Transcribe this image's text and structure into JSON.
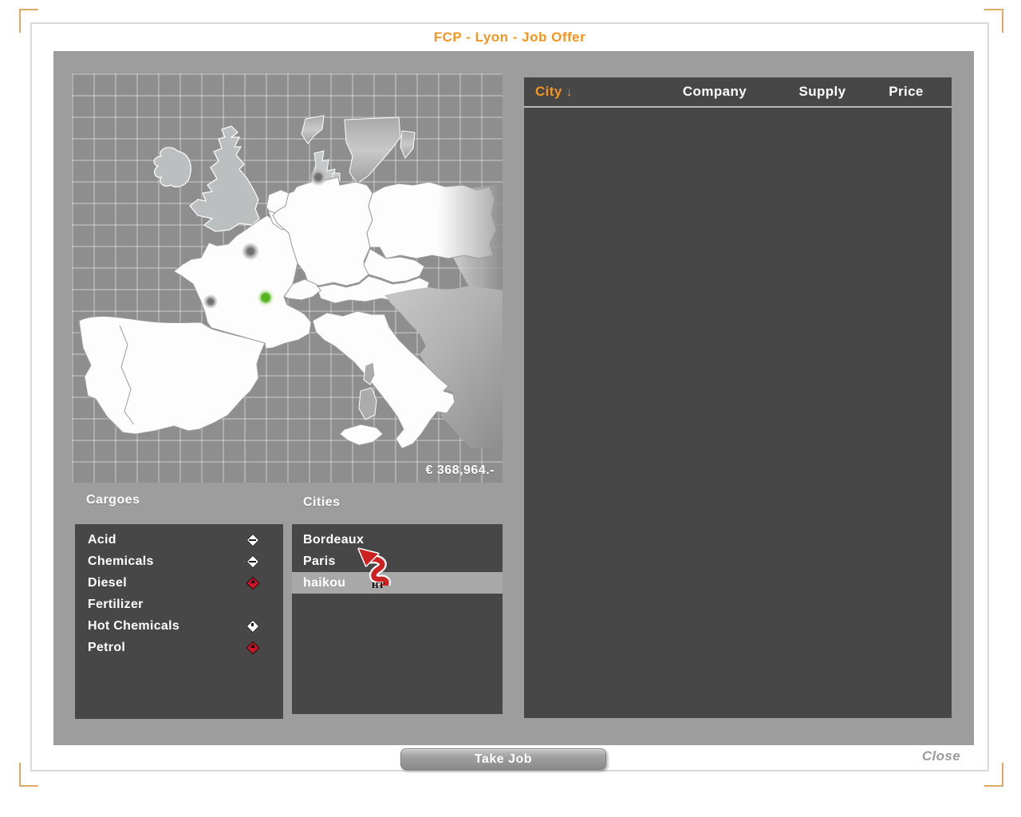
{
  "window": {
    "title": "FCP - Lyon - Job Offer"
  },
  "map": {
    "money_label": "€ 368,964.-",
    "dots": [
      {
        "name": "city-dot-north",
        "type": "gray"
      },
      {
        "name": "city-dot-paris",
        "type": "gray"
      },
      {
        "name": "city-dot-bordeaux",
        "type": "gray"
      },
      {
        "name": "city-dot-lyon-selected",
        "type": "green"
      }
    ]
  },
  "cargoes": {
    "label": "Cargoes",
    "items": [
      {
        "name": "Acid",
        "icon": "diamond-white-band"
      },
      {
        "name": "Chemicals",
        "icon": "diamond-white-band"
      },
      {
        "name": "Diesel",
        "icon": "diamond-red-flame"
      },
      {
        "name": "Fertilizer",
        "icon": "none"
      },
      {
        "name": "Hot Chemicals",
        "icon": "diamond-white-dot"
      },
      {
        "name": "Petrol",
        "icon": "diamond-red-flame"
      }
    ]
  },
  "cities": {
    "label": "Cities",
    "items": [
      {
        "name": "Bordeaux",
        "selected": "false"
      },
      {
        "name": "Paris",
        "selected": "false"
      },
      {
        "name": "haikou",
        "selected": "true"
      }
    ]
  },
  "table": {
    "sort_arrow": "↓",
    "columns": [
      {
        "label": "City"
      },
      {
        "label": "Company"
      },
      {
        "label": "Supply"
      },
      {
        "label": "Price"
      }
    ],
    "rows": []
  },
  "actions": {
    "take_job_label": "Take Job",
    "close_label": "Close"
  },
  "cursor": {
    "label": "HT"
  },
  "colors": {
    "accent_orange": "#f5941f",
    "panel_gray": "#9d9d9d",
    "panel_dark": "#474747",
    "map_sea": "#8e8e8e",
    "diamond_red": "#cf1428",
    "dot_green": "#55b41e",
    "highlight_row": "#a8a8a8",
    "bracket_orange": "#dfa963"
  }
}
